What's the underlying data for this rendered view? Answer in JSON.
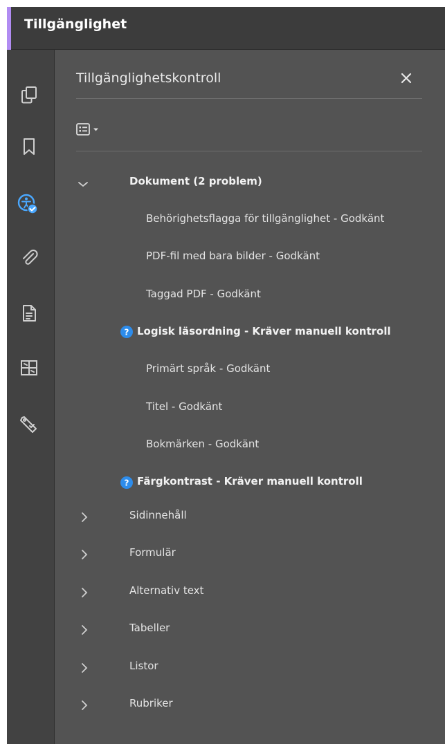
{
  "titlebar": {
    "title": "Tillgänglighet"
  },
  "rail": {
    "icons": [
      "pages-icon",
      "bookmark-icon",
      "accessibility-icon",
      "attachment-icon",
      "document-properties-icon",
      "content-icon",
      "tags-icon"
    ],
    "active": "accessibility-icon"
  },
  "panel": {
    "title": "Tillgänglighetskontroll",
    "close_icon": "close-icon",
    "options_icon": "options-list-icon",
    "tree": {
      "document": {
        "label": "Dokument (2 problem)",
        "children": [
          "Behörighetsflagga för tillgänglighet - Godkänt",
          "PDF-fil med bara bilder - Godkänt",
          "Taggad PDF - Godkänt",
          "Logisk läsordning - Kräver manuell kontroll",
          "Primärt språk - Godkänt",
          "Titel - Godkänt",
          "Bokmärken - Godkänt",
          "Färgkontrast - Kräver manuell kontroll"
        ]
      },
      "sections": [
        "Sidinnehåll",
        "Formulär",
        "Alternativ text",
        "Tabeller",
        "Listor",
        "Rubriker"
      ]
    }
  },
  "colors": {
    "titlebar_accent": "#b18cf2",
    "active_icon": "#4aa8ff",
    "panel_bg": "#535353",
    "question_icon": "#2d8ceb"
  }
}
